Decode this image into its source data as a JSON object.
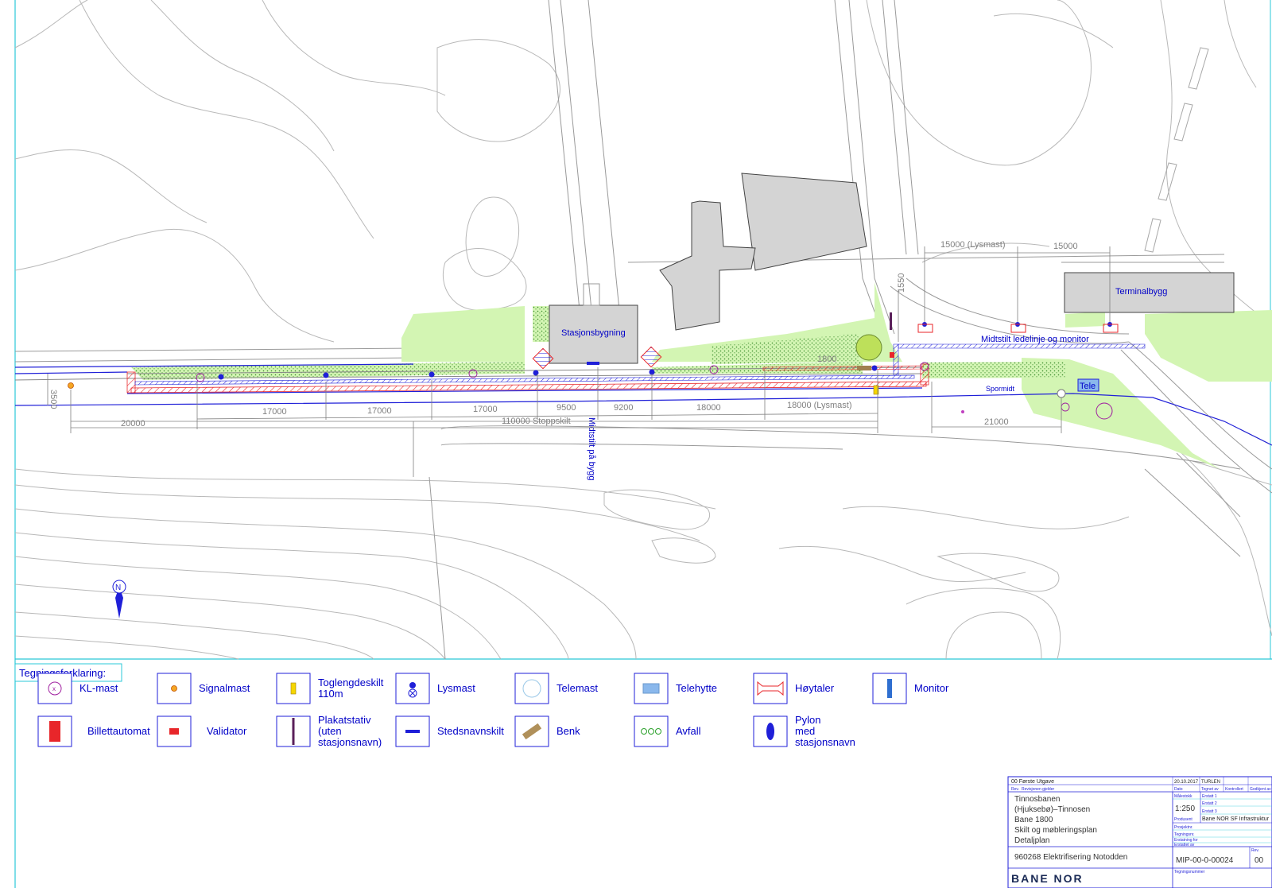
{
  "plan": {
    "buildings": {
      "stasjon": "Stasjonsbygning",
      "terminal": "Terminalbygg",
      "tele": "Tele"
    },
    "labels": {
      "midtstilt_ledelinje": "Midtstilt ledelinje og monitor",
      "midtstilt_bygg": "Midtstilt på bygg",
      "spormidt": "Spormidt"
    },
    "dimensions": {
      "d3500": "3500",
      "d20000": "20000",
      "d17000a": "17000",
      "d17000b": "17000",
      "d17000c": "17000",
      "d9500": "9500",
      "d9200": "9200",
      "d18000": "18000",
      "d18000_lys": "18000 (Lysmast)",
      "d110000": "110000 Stoppskilt",
      "d21000": "21000",
      "d15000_lys": "15000 (Lysmast)",
      "d15000": "15000",
      "d1550": "1550",
      "d1800": "1800"
    },
    "north": "N"
  },
  "legend": {
    "title": "Tegningsforklaring:",
    "items": [
      {
        "label": "KL-mast",
        "icon": "kl-mast-icon"
      },
      {
        "label": "Signalmast",
        "icon": "signalmast-icon"
      },
      {
        "label": "Toglengdeskilt 110m",
        "icon": "toglengdeskilt-icon"
      },
      {
        "label": "Lysmast",
        "icon": "lysmast-icon"
      },
      {
        "label": "Telemast",
        "icon": "telemast-icon"
      },
      {
        "label": "Telehytte",
        "icon": "telehytte-icon"
      },
      {
        "label": "Høytaler",
        "icon": "hoytaler-icon"
      },
      {
        "label": "Monitor",
        "icon": "monitor-icon"
      },
      {
        "label": "Billettautomat",
        "icon": "billettautomat-icon"
      },
      {
        "label": "Validator",
        "icon": "validator-icon"
      },
      {
        "label": "Plakatstativ (uten stasjonsnavn)",
        "icon": "plakatstativ-icon"
      },
      {
        "label": "Stedsnavnskilt",
        "icon": "stedsnavnskilt-icon"
      },
      {
        "label": "Benk",
        "icon": "benk-icon"
      },
      {
        "label": "Avfall",
        "icon": "avfall-icon"
      },
      {
        "label": "Pylon med stasjonsnavn",
        "icon": "pylon-icon"
      }
    ]
  },
  "title_block": {
    "rev_row": "00  Første Utgave",
    "rev_date": "20.10.2017",
    "rev_by": "TURLEN",
    "hdr_rev": "Rev.",
    "hdr_text": "Revisjonen gjelder",
    "hdr_dato": "Dato",
    "hdr_tegnet": "Tegnet av",
    "hdr_kontrollert": "Kontrollert",
    "hdr_godkjent": "Godkjent av",
    "project_line1": "Tinnosbanen",
    "project_line2": "(Hjuksebø)–Tinnosen",
    "project_line3": "Bane 1800",
    "project_line4": "Skilt og møbleringsplan",
    "project_line5": "Detaljplan",
    "contract": "960268 Elektrifisering Notodden",
    "scale_label": "Målestokk",
    "scale": "1:250",
    "erstatt1": "Erstatt 1",
    "erstatt2": "Erstatt 2",
    "erstatt3": "Erstatt 3",
    "produsent_label": "Produsent",
    "produsent": "Bane NOR SF Infrastruktur",
    "prosjekt_label": "Prosjektnr.",
    "tegning_label": "Tegningsnr.",
    "erstattning_label": "Erstatning for",
    "erstattet_label": "Erstattet av",
    "drawing_no": "MIP-00-0-00024",
    "drawing_rev": "00",
    "rev_label": "Rev.",
    "tegningsnr_label2": "Tegningsnummer",
    "logo": "BANE NOR"
  },
  "colors": {
    "grass": "#d3f5b3",
    "building": "#d4d4d4",
    "track": "#1f1fd8",
    "platform_hatch": "#e8262a",
    "dim": "#808080",
    "text_blue": "#0000c8",
    "cyan": "#2bc8d8"
  }
}
